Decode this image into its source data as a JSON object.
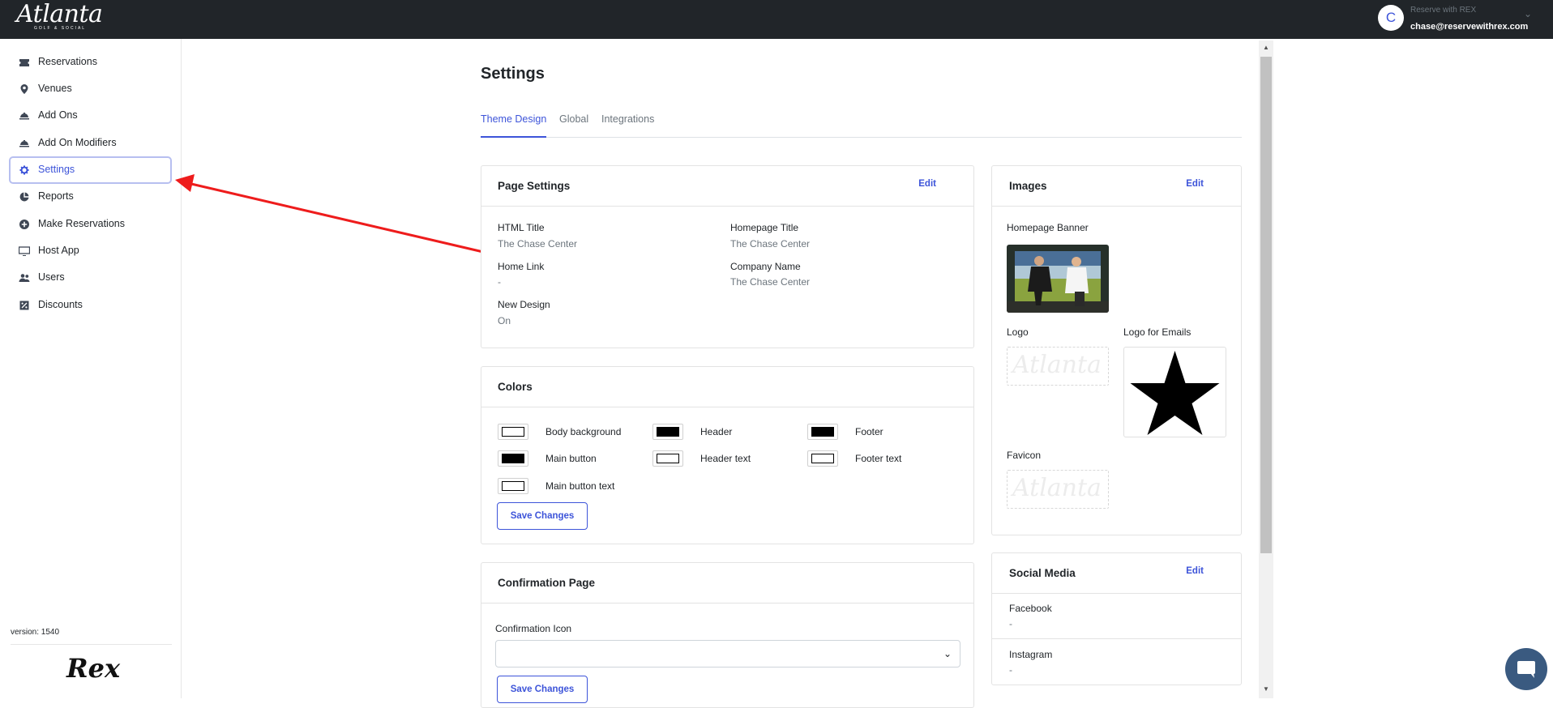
{
  "topbar": {
    "brand_name": "Atlanta",
    "brand_tagline": "GOLF & SOCIAL",
    "avatar_letter": "C",
    "org_name": "Reserve with REX",
    "email": "chase@reservewithrex.com"
  },
  "sidebar": {
    "items": [
      {
        "label": "Reservations",
        "icon": "ticket-icon"
      },
      {
        "label": "Venues",
        "icon": "map-pin-icon"
      },
      {
        "label": "Add Ons",
        "icon": "food-tray-icon"
      },
      {
        "label": "Add On Modifiers",
        "icon": "food-tray-icon"
      },
      {
        "label": "Settings",
        "icon": "gear-icon"
      },
      {
        "label": "Reports",
        "icon": "pie-chart-icon"
      },
      {
        "label": "Make Reservations",
        "icon": "plus-circle-icon"
      },
      {
        "label": "Host App",
        "icon": "monitor-icon"
      },
      {
        "label": "Users",
        "icon": "users-icon"
      },
      {
        "label": "Discounts",
        "icon": "percent-tag-icon"
      }
    ],
    "active_item": "Settings",
    "version": "version: 1540",
    "footer_logo": "Rex"
  },
  "page": {
    "title": "Settings",
    "tabs": [
      "Theme Design",
      "Global",
      "Integrations"
    ],
    "active_tab": "Theme Design"
  },
  "page_settings": {
    "title": "Page Settings",
    "edit_label": "Edit",
    "fields": [
      {
        "label": "HTML Title",
        "value": "The Chase Center"
      },
      {
        "label": "Homepage Title",
        "value": "The Chase Center"
      },
      {
        "label": "Home Link",
        "value": "-"
      },
      {
        "label": "Company Name",
        "value": "The Chase Center"
      },
      {
        "label": "New Design",
        "value": "On"
      }
    ]
  },
  "colors": {
    "title": "Colors",
    "items": [
      {
        "label": "Body background",
        "color": "#ffffff"
      },
      {
        "label": "Header",
        "color": "#000000"
      },
      {
        "label": "Footer",
        "color": "#000000"
      },
      {
        "label": "Main button",
        "color": "#000000"
      },
      {
        "label": "Header text",
        "color": "#ffffff"
      },
      {
        "label": "Footer text",
        "color": "#ffffff"
      },
      {
        "label": "Main button text",
        "color": "#ffffff"
      }
    ],
    "save_label": "Save Changes"
  },
  "confirmation_page": {
    "title": "Confirmation Page",
    "icon_label": "Confirmation Icon",
    "icon_value": "",
    "save_label": "Save Changes"
  },
  "images": {
    "title": "Images",
    "edit_label": "Edit",
    "homepage_banner_label": "Homepage Banner",
    "logo_label": "Logo",
    "logo_emails_label": "Logo for Emails",
    "favicon_label": "Favicon",
    "placeholder_text": "Atlanta"
  },
  "social_media": {
    "title": "Social Media",
    "edit_label": "Edit",
    "items": [
      {
        "label": "Facebook",
        "value": "-"
      },
      {
        "label": "Instagram",
        "value": "-"
      }
    ]
  },
  "accent_color": "#3d54d9",
  "annotation_color": "#ee1c1c"
}
